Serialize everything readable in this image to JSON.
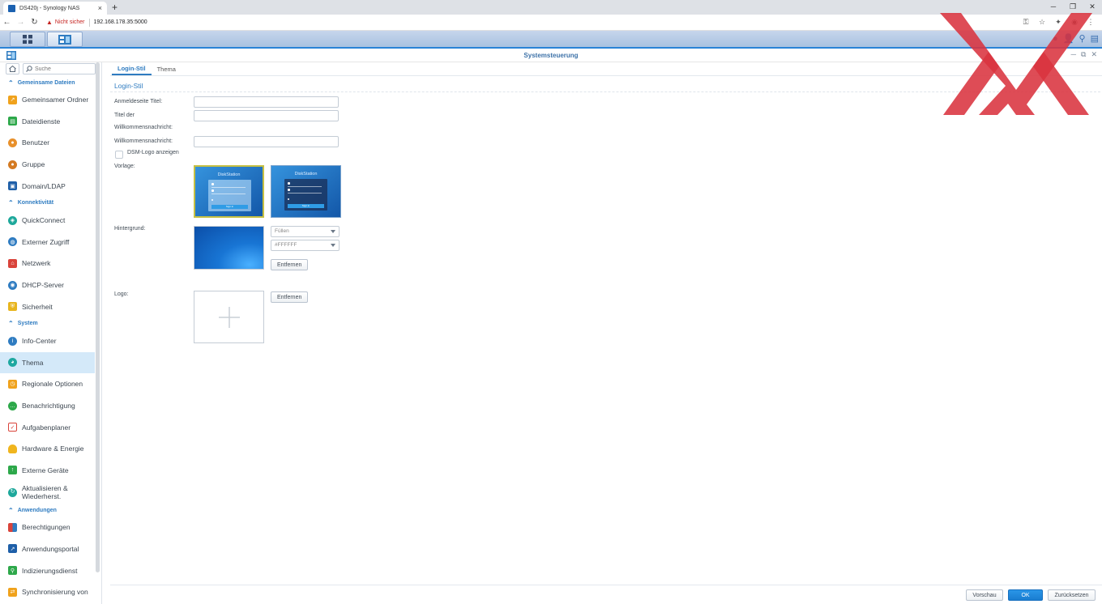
{
  "browser": {
    "tab_title": "DS420j - Synology NAS",
    "tab_close": "×",
    "new_tab": "+",
    "not_secure": "Nicht sicher",
    "url": "192.168.178.35:5000"
  },
  "window": {
    "title": "Systemsteuerung"
  },
  "sidebar": {
    "search_placeholder": "Suche",
    "categories": {
      "shared": "Gemeinsame Dateien",
      "connectivity": "Konnektivität",
      "system": "System",
      "apps": "Anwendungen"
    },
    "items": {
      "shared_folder": "Gemeinsamer Ordner",
      "file_services": "Dateidienste",
      "user": "Benutzer",
      "group": "Gruppe",
      "domain": "Domain/LDAP",
      "quickconnect": "QuickConnect",
      "external_access": "Externer Zugriff",
      "network": "Netzwerk",
      "dhcp": "DHCP-Server",
      "security": "Sicherheit",
      "info_center": "Info-Center",
      "theme": "Thema",
      "regional": "Regionale Optionen",
      "notification": "Benachrichtigung",
      "task_scheduler": "Aufgabenplaner",
      "hardware": "Hardware & Energie",
      "external_devices": "Externe Geräte",
      "update_line1": "Aktualisieren &",
      "update_line2": "Wiederherst.",
      "privileges": "Berechtigungen",
      "app_portal": "Anwendungsportal",
      "indexing": "Indizierungsdienst",
      "sync": "Synchronisierung von"
    }
  },
  "main": {
    "tabs": [
      "Login-Stil",
      "Thema"
    ],
    "section_title": "Login-Stil",
    "labels": {
      "login_title": "Anmeldeseite Titel:",
      "welcome_title_1": "Titel der",
      "welcome_title_2": "Willkommensnachricht:",
      "welcome_msg": "Willkommensnachricht:",
      "show_logo": "DSM-Logo anzeigen",
      "template": "Vorlage:",
      "background": "Hintergrund:",
      "logo": "Logo:"
    },
    "inputs": {
      "login_title": "",
      "welcome_title": "",
      "welcome_msg": ""
    },
    "template_thumb": {
      "brand": "DiskStation",
      "signin": "Sign in"
    },
    "bg_fill": "Füllen",
    "bg_color": "#FFFFFF",
    "remove": "Entfernen"
  },
  "footer": {
    "preview": "Vorschau",
    "ok": "OK",
    "reset": "Zurücksetzen"
  },
  "colors": {
    "accent": "#2f7cc1",
    "ok_button": "#1a7dd0",
    "watermark": "#d9333f"
  }
}
